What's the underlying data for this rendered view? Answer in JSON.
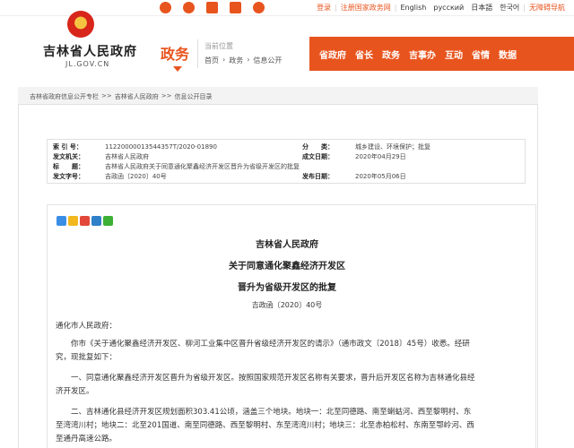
{
  "top": {
    "social_icons": [
      "weibo-icon",
      "wechat-icon",
      "app-icon",
      "feedback-icon",
      "accessibility-icon"
    ],
    "links": {
      "login": "登录",
      "register": "注册国家政务网",
      "english": "English",
      "russian": "русский",
      "japanese": "日本語",
      "korean": "한국어",
      "accessible": "无障碍导航"
    }
  },
  "header": {
    "site_title": "吉林省人民政府",
    "site_domain": "JL.GOV.CN",
    "section": "政务",
    "location_label": "当前位置",
    "location_path": [
      "首页",
      "›",
      "政务",
      "›",
      "信息公开"
    ]
  },
  "nav": [
    "省政府",
    "省长",
    "政务",
    "吉事办",
    "互动",
    "省情",
    "数据"
  ],
  "breadcrumb": [
    "吉林省政府信息公开专栏",
    ">>",
    "吉林省人民政府",
    ">>",
    "信息公开目录"
  ],
  "meta": {
    "index_label": "索 引 号：",
    "index_value": "11220000013544357T/2020-01890",
    "category_label": "分　　类：",
    "category_value": "城乡建设、环境保护；批复",
    "issuer_label": "发文机关：",
    "issuer_value": "吉林省人民政府",
    "date_label": "成文日期：",
    "date_value": "2020年04月29日",
    "title_label": "标　　题：",
    "title_value": "吉林省人民政府关于同意通化聚鑫经济开发区晋升为省级开发区的批复",
    "docno_label": "发文字号：",
    "docno_value": "吉政函〔2020〕40号",
    "pubdate_label": "发布日期：",
    "pubdate_value": "2020年05月06日"
  },
  "share_icons": [
    "share-plus-icon",
    "qzone-icon",
    "weibo-share-icon",
    "renren-icon",
    "wechat-share-icon"
  ],
  "doc": {
    "issuer": "吉林省人民政府",
    "title_line1": "关于同意通化聚鑫经济开发区",
    "title_line2": "晋升为省级开发区的批复",
    "doc_number": "吉政函〔2020〕40号",
    "salutation": "通化市人民政府：",
    "p1a": "你市《关于通化聚鑫经济开发区、柳河工业集中区晋升省级经济开发区的请示》（通市政文〔2018〕45号）收悉。经研",
    "p1b": "究，现批复如下：",
    "p2a": "一、同意通化聚鑫经济开发区晋升为省级开发区。按照国家规范开发区名称有关要求，晋升后开发区名称为吉林通化县经",
    "p2b": "济开发区。",
    "p3a": "二、吉林通化县经济开发区规划面积303.41公顷，涵盖三个地块。地块一：北至同德路、南至蝲蛄河、西至黎明村、东",
    "p3b": "至湾湾川村；地块二：北至201国道、南至同德路、西至黎明村、东至湾湾川村；地块三：北至赤柏松村、东南至鄂岭河、西",
    "p3c": "至通丹高速公路。"
  }
}
